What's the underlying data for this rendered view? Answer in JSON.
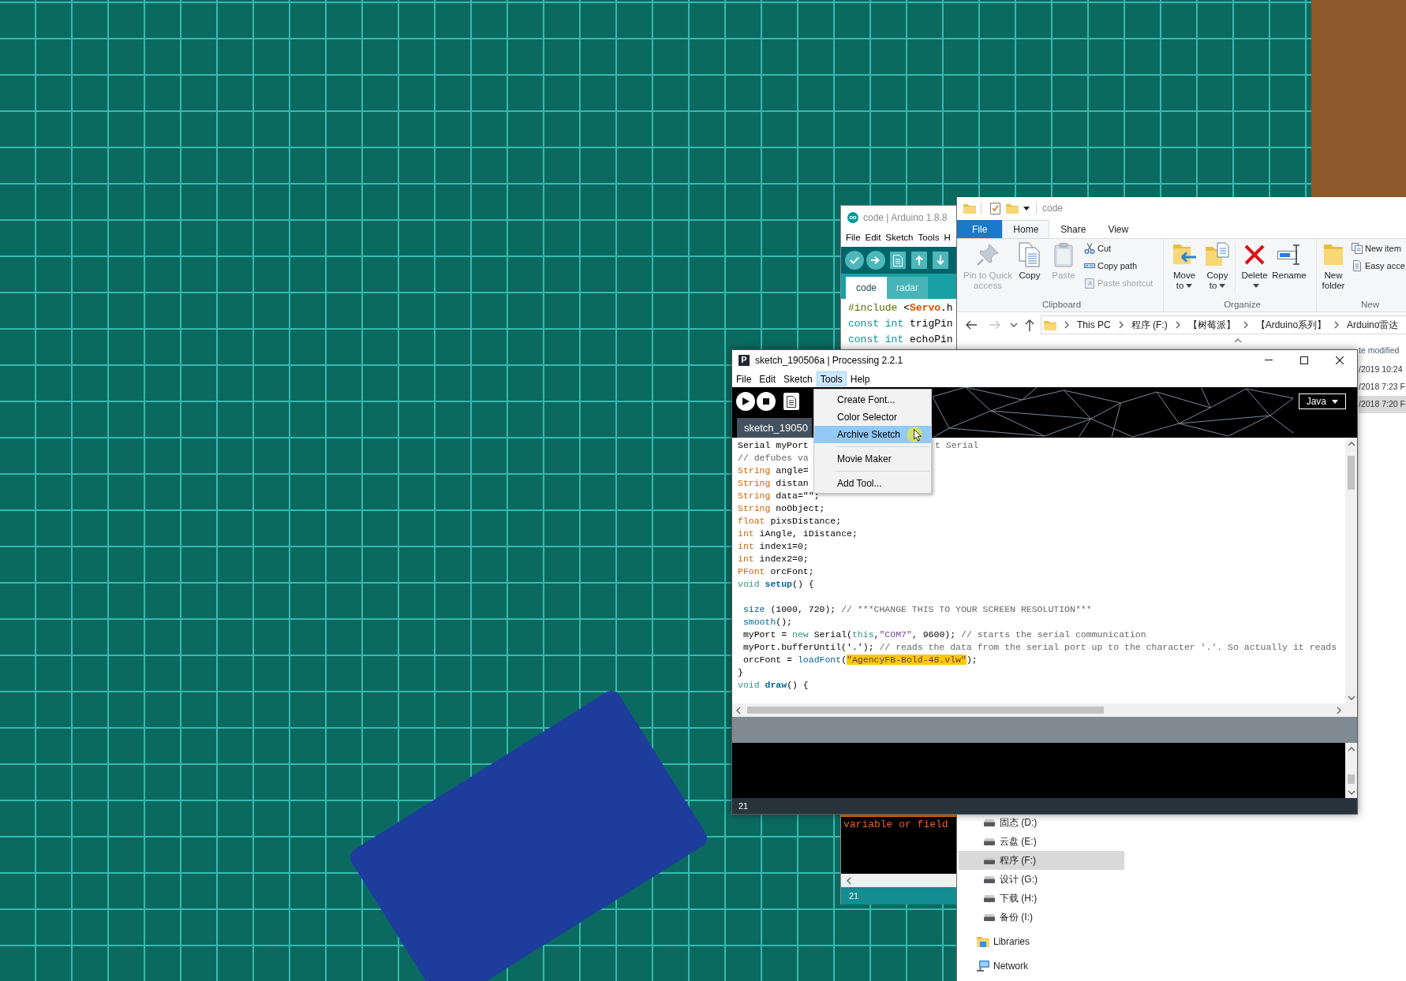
{
  "explorer_window": {
    "title": "code",
    "ribbon_tabs": [
      {
        "label": "File",
        "kind": "backstage",
        "selected": false
      },
      {
        "label": "Home",
        "kind": "tab",
        "selected": true
      },
      {
        "label": "Share",
        "kind": "tab",
        "selected": false
      },
      {
        "label": "View",
        "kind": "tab",
        "selected": false
      }
    ],
    "ribbon_groups": [
      {
        "label": "Clipboard",
        "commands": [
          {
            "label": "Pin to Quick access",
            "kind": "large",
            "disabled": true,
            "dropdown": false
          },
          {
            "label": "Copy",
            "kind": "large",
            "disabled": false,
            "dropdown": false
          },
          {
            "label": "Paste",
            "kind": "large",
            "disabled": true,
            "dropdown": false
          },
          {
            "label": "Cut",
            "kind": "small",
            "disabled": false,
            "dropdown": false
          },
          {
            "label": "Copy path",
            "kind": "small",
            "disabled": false,
            "dropdown": false
          },
          {
            "label": "Paste shortcut",
            "kind": "small",
            "disabled": true,
            "dropdown": false
          }
        ]
      },
      {
        "label": "Organize",
        "commands": [
          {
            "label": "Move to",
            "kind": "large",
            "disabled": false,
            "dropdown": true
          },
          {
            "label": "Copy to",
            "kind": "large",
            "disabled": false,
            "dropdown": true
          },
          {
            "label": "Delete",
            "kind": "large",
            "disabled": false,
            "dropdown": true
          },
          {
            "label": "Rename",
            "kind": "large",
            "disabled": false,
            "dropdown": false
          }
        ]
      },
      {
        "label": "New",
        "commands": [
          {
            "label": "New folder",
            "kind": "large",
            "disabled": false,
            "dropdown": false
          },
          {
            "label": "New item",
            "kind": "small",
            "disabled": false,
            "dropdown": false
          },
          {
            "label": "Easy acce",
            "kind": "small",
            "disabled": false,
            "dropdown": false
          }
        ]
      }
    ],
    "breadcrumbs": [
      "This PC",
      "程序 (F:)",
      "【树莓派】",
      "【Arduino系列】",
      "Arduino雷达"
    ],
    "file_list": {
      "column_2_header": "te modified",
      "rows": [
        {
          "column_2": "/2019 10:24",
          "selected": false
        },
        {
          "column_2": "/2018 7:23 F",
          "selected": false
        },
        {
          "column_2": "/2018 7:20 F",
          "selected": true
        }
      ]
    },
    "nav_pane": [
      {
        "label": "固态 (D:)",
        "kind": "drive",
        "selected": false
      },
      {
        "label": "云盘 (E:)",
        "kind": "drive",
        "selected": false
      },
      {
        "label": "程序 (F:)",
        "kind": "drive",
        "selected": true
      },
      {
        "label": "设计 (G:)",
        "kind": "drive",
        "selected": false
      },
      {
        "label": "下载 (H:)",
        "kind": "drive",
        "selected": false
      },
      {
        "label": "备份 (I:)",
        "kind": "drive",
        "selected": false
      },
      {
        "label": "Libraries",
        "kind": "libraries",
        "selected": false
      },
      {
        "label": "Network",
        "kind": "network",
        "selected": false
      }
    ]
  },
  "arduino_window": {
    "title": "code | Arduino 1.8.8",
    "menu": [
      "File",
      "Edit",
      "Sketch",
      "Tools",
      "H"
    ],
    "tabs": [
      {
        "label": "code",
        "selected": true
      },
      {
        "label": "radar",
        "selected": false
      }
    ],
    "code_lines": [
      [
        {
          "kind": "directive",
          "text": "#include"
        },
        {
          "kind": "plain",
          "text": " <"
        },
        {
          "kind": "class",
          "text": "Servo"
        },
        {
          "kind": "plain",
          "text": ".h"
        }
      ],
      [
        {
          "kind": "keyword",
          "text": "const int"
        },
        {
          "kind": "plain",
          "text": " trigPin"
        }
      ],
      [
        {
          "kind": "keyword",
          "text": "const int"
        },
        {
          "kind": "plain",
          "text": " echoPin"
        }
      ]
    ],
    "console_lines": [
      "variable or field"
    ],
    "line_number": "21"
  },
  "processing_window": {
    "logo": "P",
    "title": "sketch_190506a | Processing 2.2.1",
    "menu": [
      {
        "label": "File",
        "selected": false
      },
      {
        "label": "Edit",
        "selected": false
      },
      {
        "label": "Sketch",
        "selected": false
      },
      {
        "label": "Tools",
        "selected": true
      },
      {
        "label": "Help",
        "selected": false
      }
    ],
    "tools_menu": [
      {
        "kind": "item",
        "label": "Create Font...",
        "selected": false
      },
      {
        "kind": "item",
        "label": "Color Selector",
        "selected": false
      },
      {
        "kind": "item",
        "label": "Archive Sketch",
        "selected": true
      },
      {
        "kind": "separator"
      },
      {
        "kind": "item",
        "label": "Movie Maker",
        "selected": false
      },
      {
        "kind": "separator"
      },
      {
        "kind": "item",
        "label": "Add Tool...",
        "selected": false
      }
    ],
    "mode": "Java",
    "tab": "sketch_19050",
    "code_lines": [
      {
        "kind": "code",
        "tokens": [
          {
            "kind": "plain",
            "text": "Serial myPort"
          }
        ],
        "after_menu": [
          {
            "kind": "comment",
            "text": "t Serial"
          }
        ]
      },
      {
        "kind": "code",
        "tokens": [
          {
            "kind": "comment",
            "text": "// defubes va"
          }
        ]
      },
      {
        "kind": "code",
        "tokens": [
          {
            "kind": "type",
            "text": "String"
          },
          {
            "kind": "plain",
            "text": " angle="
          }
        ]
      },
      {
        "kind": "code",
        "tokens": [
          {
            "kind": "type",
            "text": "String"
          },
          {
            "kind": "plain",
            "text": " distan"
          }
        ]
      },
      {
        "kind": "code",
        "tokens": [
          {
            "kind": "type",
            "text": "String"
          },
          {
            "kind": "plain",
            "text": " data=\"\";"
          }
        ]
      },
      {
        "kind": "code",
        "tokens": [
          {
            "kind": "type",
            "text": "String"
          },
          {
            "kind": "plain",
            "text": " noObject;"
          }
        ]
      },
      {
        "kind": "code",
        "tokens": [
          {
            "kind": "type",
            "text": "float"
          },
          {
            "kind": "plain",
            "text": " pixsDistance;"
          }
        ]
      },
      {
        "kind": "code",
        "tokens": [
          {
            "kind": "type",
            "text": "int"
          },
          {
            "kind": "plain",
            "text": " iAngle, iDistance;"
          }
        ]
      },
      {
        "kind": "code",
        "tokens": [
          {
            "kind": "type",
            "text": "int"
          },
          {
            "kind": "plain",
            "text": " index1=0;"
          }
        ]
      },
      {
        "kind": "code",
        "tokens": [
          {
            "kind": "type",
            "text": "int"
          },
          {
            "kind": "plain",
            "text": " index2=0;"
          }
        ]
      },
      {
        "kind": "code",
        "tokens": [
          {
            "kind": "type",
            "text": "PFont"
          },
          {
            "kind": "plain",
            "text": " orcFont;"
          }
        ]
      },
      {
        "kind": "code",
        "tokens": [
          {
            "kind": "keyword",
            "text": "void "
          },
          {
            "kind": "function",
            "text": "setup"
          },
          {
            "kind": "plain",
            "text": "() {"
          }
        ]
      },
      {
        "kind": "blank"
      },
      {
        "kind": "code",
        "tokens": [
          {
            "kind": "builtin",
            "text": " size"
          },
          {
            "kind": "plain",
            "text": " (1000, 720); "
          },
          {
            "kind": "comment",
            "text": "// ***CHANGE THIS TO YOUR SCREEN RESOLUTION***"
          }
        ]
      },
      {
        "kind": "code",
        "tokens": [
          {
            "kind": "builtin",
            "text": " smooth"
          },
          {
            "kind": "plain",
            "text": "();"
          }
        ]
      },
      {
        "kind": "code",
        "tokens": [
          {
            "kind": "plain",
            "text": " myPort = "
          },
          {
            "kind": "keyword",
            "text": "new"
          },
          {
            "kind": "plain",
            "text": " Serial("
          },
          {
            "kind": "keyword",
            "text": "this"
          },
          {
            "kind": "plain",
            "text": ","
          },
          {
            "kind": "string",
            "text": "\"COM7\""
          },
          {
            "kind": "plain",
            "text": ", 9600); "
          },
          {
            "kind": "comment",
            "text": "// starts the serial communication"
          }
        ]
      },
      {
        "kind": "code",
        "tokens": [
          {
            "kind": "plain",
            "text": " myPort.bufferUntil('.'); "
          },
          {
            "kind": "comment",
            "text": "// reads the data from the serial port up to the character '.'. So actually it reads"
          }
        ]
      },
      {
        "kind": "code",
        "tokens": [
          {
            "kind": "plain",
            "text": " orcFont = "
          },
          {
            "kind": "builtin",
            "text": "loadFont"
          },
          {
            "kind": "plain",
            "text": "("
          },
          {
            "kind": "highlight",
            "text": "\"AgencyFB-Bold-48.vlw\""
          },
          {
            "kind": "plain",
            "text": ");"
          }
        ]
      },
      {
        "kind": "code",
        "tokens": [
          {
            "kind": "plain",
            "text": "}"
          }
        ]
      },
      {
        "kind": "code",
        "tokens": [
          {
            "kind": "keyword",
            "text": "void "
          },
          {
            "kind": "function",
            "text": "draw"
          },
          {
            "kind": "plain",
            "text": "() {"
          }
        ]
      }
    ],
    "line_number": "21"
  }
}
